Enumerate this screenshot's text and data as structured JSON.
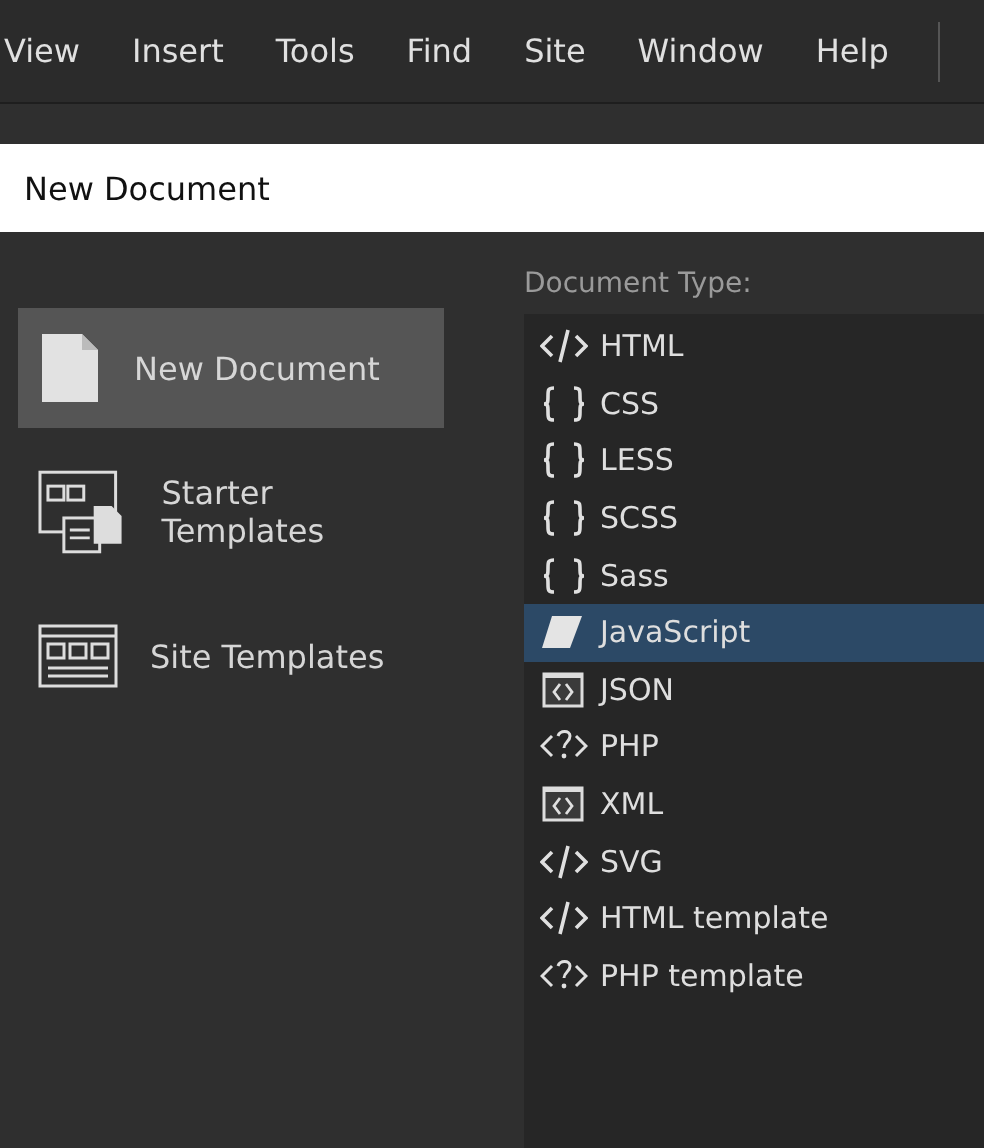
{
  "menu": [
    "View",
    "Insert",
    "Tools",
    "Find",
    "Site",
    "Window",
    "Help"
  ],
  "title_field": {
    "value": "New Document"
  },
  "categories": [
    {
      "label": "New Document",
      "kind": "document",
      "selected": true
    },
    {
      "label": "Starter Templates",
      "kind": "starter",
      "selected": false
    },
    {
      "label": "Site Templates",
      "kind": "site",
      "selected": false
    }
  ],
  "document_type": {
    "heading": "Document Type:",
    "items": [
      {
        "label": "HTML",
        "kind": "tag",
        "selected": false
      },
      {
        "label": "CSS",
        "kind": "braces",
        "selected": false
      },
      {
        "label": "LESS",
        "kind": "braces",
        "selected": false
      },
      {
        "label": "SCSS",
        "kind": "braces",
        "selected": false
      },
      {
        "label": "Sass",
        "kind": "braces",
        "selected": false
      },
      {
        "label": "JavaScript",
        "kind": "script",
        "selected": true
      },
      {
        "label": "JSON",
        "kind": "boxed",
        "selected": false
      },
      {
        "label": "PHP",
        "kind": "php",
        "selected": false
      },
      {
        "label": "XML",
        "kind": "boxed",
        "selected": false
      },
      {
        "label": "SVG",
        "kind": "tag",
        "selected": false
      },
      {
        "label": "HTML template",
        "kind": "tag",
        "selected": false
      },
      {
        "label": "PHP template",
        "kind": "php",
        "selected": false
      }
    ]
  }
}
